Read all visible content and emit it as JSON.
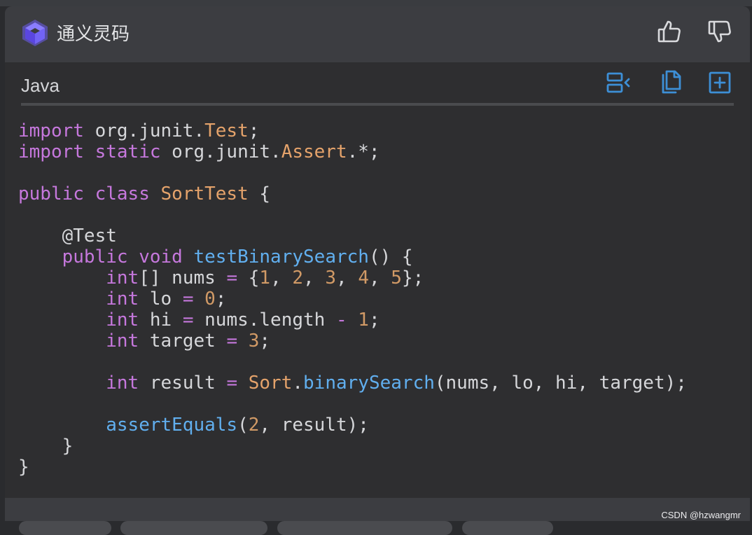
{
  "header": {
    "brand_name": "通义灵码",
    "logo_icon": "tongyi-logo-icon",
    "like_icon": "thumbs-up-icon",
    "dislike_icon": "thumbs-down-icon"
  },
  "code_block": {
    "language": "Java",
    "tools": [
      {
        "icon": "insert-at-cursor-icon"
      },
      {
        "icon": "copy-icon"
      },
      {
        "icon": "new-file-icon"
      }
    ],
    "lines": [
      [
        {
          "t": "import",
          "c": "kw"
        },
        {
          "t": " org.junit.",
          "c": "pl"
        },
        {
          "t": "Test",
          "c": "ty"
        },
        {
          "t": ";",
          "c": "pl"
        }
      ],
      [
        {
          "t": "import",
          "c": "kw"
        },
        {
          "t": " ",
          "c": "pl"
        },
        {
          "t": "static",
          "c": "kw"
        },
        {
          "t": " org.junit.",
          "c": "pl"
        },
        {
          "t": "Assert",
          "c": "ty"
        },
        {
          "t": ".*;",
          "c": "pl"
        }
      ],
      [],
      [
        {
          "t": "public",
          "c": "kw"
        },
        {
          "t": " ",
          "c": "pl"
        },
        {
          "t": "class",
          "c": "kw"
        },
        {
          "t": " ",
          "c": "pl"
        },
        {
          "t": "SortTest",
          "c": "ty"
        },
        {
          "t": " {",
          "c": "pl"
        }
      ],
      [],
      [
        {
          "t": "    @Test",
          "c": "pl"
        }
      ],
      [
        {
          "t": "    ",
          "c": "pl"
        },
        {
          "t": "public",
          "c": "kw"
        },
        {
          "t": " ",
          "c": "pl"
        },
        {
          "t": "void",
          "c": "kw"
        },
        {
          "t": " ",
          "c": "pl"
        },
        {
          "t": "testBinarySearch",
          "c": "fn"
        },
        {
          "t": "() {",
          "c": "pl"
        }
      ],
      [
        {
          "t": "        ",
          "c": "pl"
        },
        {
          "t": "int",
          "c": "kw"
        },
        {
          "t": "[] nums ",
          "c": "pl"
        },
        {
          "t": "=",
          "c": "op"
        },
        {
          "t": " {",
          "c": "pl"
        },
        {
          "t": "1",
          "c": "num"
        },
        {
          "t": ", ",
          "c": "pl"
        },
        {
          "t": "2",
          "c": "num"
        },
        {
          "t": ", ",
          "c": "pl"
        },
        {
          "t": "3",
          "c": "num"
        },
        {
          "t": ", ",
          "c": "pl"
        },
        {
          "t": "4",
          "c": "num"
        },
        {
          "t": ", ",
          "c": "pl"
        },
        {
          "t": "5",
          "c": "num"
        },
        {
          "t": "};",
          "c": "pl"
        }
      ],
      [
        {
          "t": "        ",
          "c": "pl"
        },
        {
          "t": "int",
          "c": "kw"
        },
        {
          "t": " lo ",
          "c": "pl"
        },
        {
          "t": "=",
          "c": "op"
        },
        {
          "t": " ",
          "c": "pl"
        },
        {
          "t": "0",
          "c": "num"
        },
        {
          "t": ";",
          "c": "pl"
        }
      ],
      [
        {
          "t": "        ",
          "c": "pl"
        },
        {
          "t": "int",
          "c": "kw"
        },
        {
          "t": " hi ",
          "c": "pl"
        },
        {
          "t": "=",
          "c": "op"
        },
        {
          "t": " nums.length ",
          "c": "pl"
        },
        {
          "t": "-",
          "c": "op"
        },
        {
          "t": " ",
          "c": "pl"
        },
        {
          "t": "1",
          "c": "num"
        },
        {
          "t": ";",
          "c": "pl"
        }
      ],
      [
        {
          "t": "        ",
          "c": "pl"
        },
        {
          "t": "int",
          "c": "kw"
        },
        {
          "t": " target ",
          "c": "pl"
        },
        {
          "t": "=",
          "c": "op"
        },
        {
          "t": " ",
          "c": "pl"
        },
        {
          "t": "3",
          "c": "num"
        },
        {
          "t": ";",
          "c": "pl"
        }
      ],
      [],
      [
        {
          "t": "        ",
          "c": "pl"
        },
        {
          "t": "int",
          "c": "kw"
        },
        {
          "t": " result ",
          "c": "pl"
        },
        {
          "t": "=",
          "c": "op"
        },
        {
          "t": " ",
          "c": "pl"
        },
        {
          "t": "Sort",
          "c": "ty"
        },
        {
          "t": ".",
          "c": "pl"
        },
        {
          "t": "binarySearch",
          "c": "fn"
        },
        {
          "t": "(nums, lo, hi, target);",
          "c": "pl"
        }
      ],
      [],
      [
        {
          "t": "        ",
          "c": "pl"
        },
        {
          "t": "assertEquals",
          "c": "fn"
        },
        {
          "t": "(",
          "c": "pl"
        },
        {
          "t": "2",
          "c": "num"
        },
        {
          "t": ", result);",
          "c": "pl"
        }
      ],
      [
        {
          "t": "    }",
          "c": "pl"
        }
      ],
      [
        {
          "t": "}",
          "c": "pl"
        }
      ]
    ]
  },
  "watermark": "CSDN @hzwangmr",
  "colors": {
    "keyword": "#c678dd",
    "type": "#e5a36b",
    "function": "#61afef",
    "number": "#d19a66",
    "tool_accent": "#3d8fd6"
  }
}
